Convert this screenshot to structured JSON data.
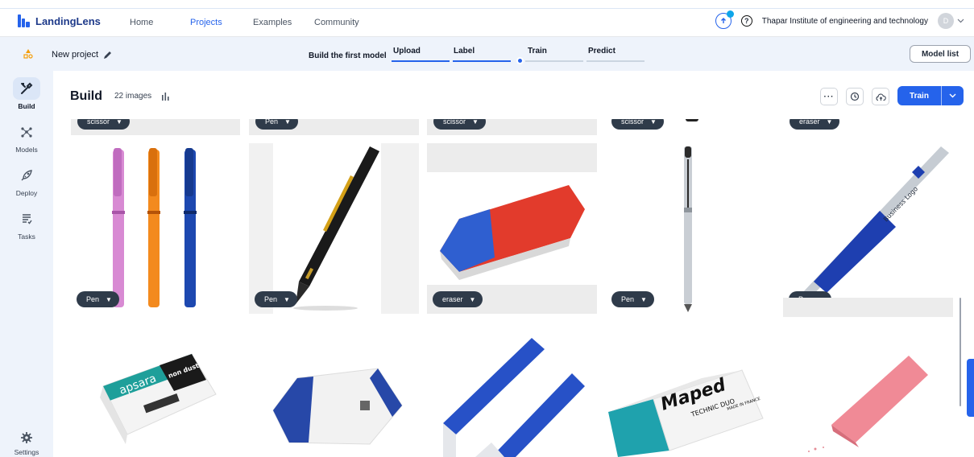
{
  "app": {
    "name": "LandingLens"
  },
  "nav": {
    "items": [
      "Home",
      "Projects",
      "Examples",
      "Community"
    ],
    "active": "Projects"
  },
  "org": {
    "name": "Thapar Institute of engineering and technology",
    "avatar_initial": "D"
  },
  "project": {
    "name": "New project"
  },
  "steps": {
    "label": "Build the first model",
    "items": [
      "Upload",
      "Label",
      "Train",
      "Predict"
    ]
  },
  "buttons": {
    "model_list": "Model list",
    "train": "Train"
  },
  "sidebar": {
    "items": [
      "Build",
      "Models",
      "Deploy",
      "Tasks"
    ],
    "settings": "Settings"
  },
  "build": {
    "title": "Build",
    "image_count": "22 images"
  },
  "tiles": {
    "row0": [
      "scissor",
      "Pen",
      "scissor",
      "scissor",
      "eraser"
    ],
    "row1": [
      "Pen",
      "Pen",
      "eraser",
      "Pen",
      "Pen"
    ]
  },
  "image_text": {
    "apsara_brand": "apsara",
    "apsara_sub": "non dust eraser",
    "maped_brand": "Maped",
    "maped_sub": "TECHNIC DUO",
    "maped_made": "MADE IN FRANCE",
    "pen_logo": "Business Logo"
  },
  "colors": {
    "accent": "#2563eb",
    "tag_bg": "#2f3b4a",
    "sidebar_bg": "#eef3fb"
  }
}
